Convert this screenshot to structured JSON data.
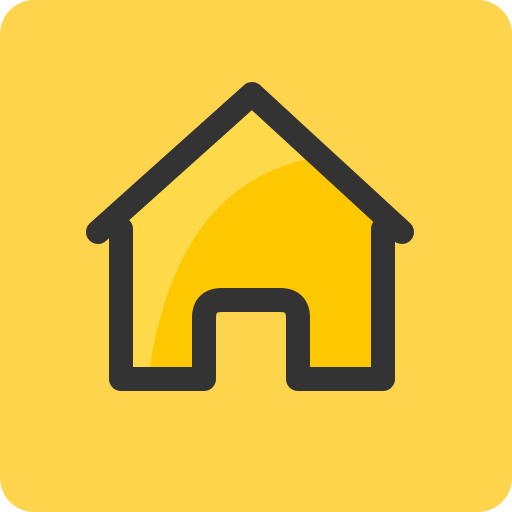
{
  "icon": {
    "name": "home-icon",
    "colors": {
      "background": "#FED44C",
      "house_fill": "#FEC800",
      "house_highlight": "#FEDA4A",
      "outline": "#333333"
    }
  }
}
